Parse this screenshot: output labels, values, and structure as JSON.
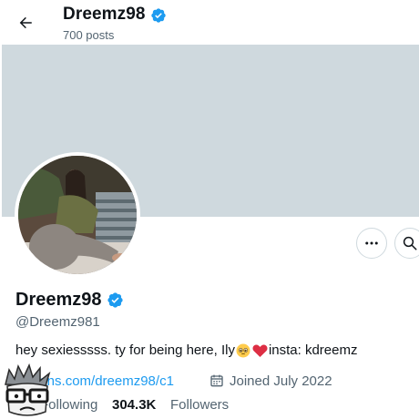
{
  "header": {
    "display_name": "Dreemz98",
    "posts_count": "700 posts"
  },
  "profile": {
    "display_name": "Dreemz98",
    "handle": "@Dreemz981",
    "bio_text": "hey sexiesssss. ty for being here, Ily",
    "bio_suffix": " insta: kdreemz",
    "link_text": "nlyfans.com/dreemz98/c1",
    "joined_text": "Joined July 2022",
    "following_label": "Following",
    "followers_count": "304.3K",
    "followers_label": "Followers"
  },
  "icons": {
    "back": "back-arrow-icon",
    "verified": "verified-badge-icon",
    "more": "more-horizontal-icon",
    "search": "search-icon",
    "calendar": "calendar-icon",
    "emoji_pleading": "pleading-face-emoji",
    "emoji_heart": "red-heart-emoji"
  },
  "colors": {
    "verified": "#1d9bf0",
    "link": "#1d9bf0",
    "muted": "#536471",
    "banner": "#cfd9de",
    "heart": "#e0245e"
  }
}
